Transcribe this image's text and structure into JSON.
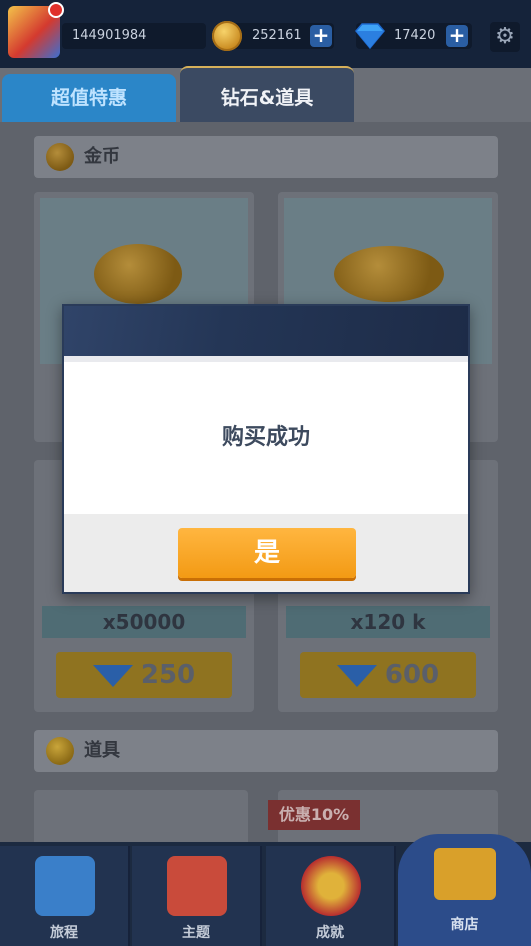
{
  "header": {
    "user_id": "144901984",
    "coins": "252161",
    "diamonds": "17420",
    "plus_label": "+",
    "settings_glyph": "⚙"
  },
  "tabs": [
    {
      "label": "超值特惠",
      "active": false
    },
    {
      "label": "钻石&道具",
      "active": true
    }
  ],
  "sections": {
    "coins_title": "金币",
    "items_title": "道具"
  },
  "offers": [
    {
      "quantity": "x50000",
      "price": "250"
    },
    {
      "quantity": "x120 k",
      "price": "600"
    }
  ],
  "discount_badge": "优惠10%",
  "nav": [
    {
      "label": "旅程"
    },
    {
      "label": "主题"
    },
    {
      "label": "成就"
    },
    {
      "label": "商店"
    }
  ],
  "dialog": {
    "message": "购买成功",
    "confirm_label": "是"
  },
  "colors": {
    "confirm_button": "#f5a623",
    "topbar": "#15233a",
    "active_tab_border": "#d6b05a"
  }
}
